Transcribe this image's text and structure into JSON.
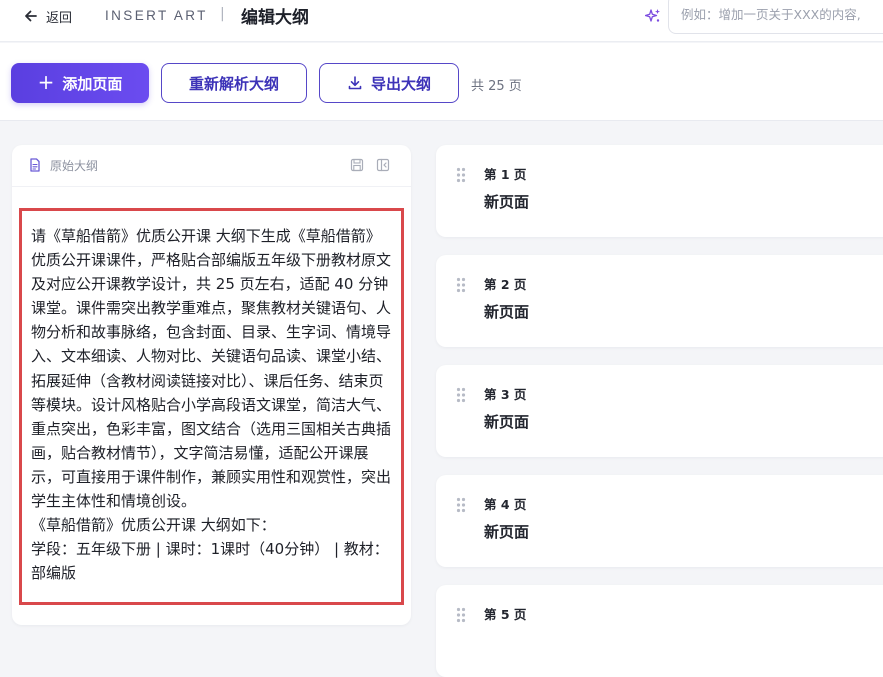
{
  "header": {
    "back_label": "返回",
    "brand": "INSERT ART",
    "separator": "|",
    "title": "编辑大纲",
    "prompt_placeholder": "例如：增加一页关于XXX的内容,"
  },
  "toolbar": {
    "add_page_label": "添加页面",
    "reparse_label": "重新解析大纲",
    "export_label": "导出大纲",
    "page_count": "共 25 页"
  },
  "outline": {
    "label": "原始大纲",
    "text": "请《草船借箭》优质公开课 大纲下生成《草船借箭》优质公开课课件，严格贴合部编版五年级下册教材原文及对应公开课教学设计，共 25 页左右，适配 40 分钟课堂。课件需突出教学重难点，聚焦教材关键语句、人物分析和故事脉络，包含封面、目录、生字词、情境导入、文本细读、人物对比、关键语句品读、课堂小结、拓展延伸（含教材阅读链接对比）、课后任务、结束页等模块。设计风格贴合小学高段语文课堂，简洁大气、重点突出，色彩丰富，图文结合（选用三国相关古典插画，贴合教材情节），文字简洁易懂，适配公开课展示，可直接用于课件制作，兼顾实用性和观赏性，突出学生主体性和情境创设。\n《草船借箭》优质公开课 大纲如下：\n学段：五年级下册 | 课时：1课时（40分钟） | 教材：部编版"
  },
  "pages": [
    {
      "num": "第 1 页",
      "title": "新页面"
    },
    {
      "num": "第 2 页",
      "title": "新页面"
    },
    {
      "num": "第 3 页",
      "title": "新页面"
    },
    {
      "num": "第 4 页",
      "title": "新页面"
    },
    {
      "num": "第 5 页",
      "title": ""
    }
  ],
  "colors": {
    "primary": "#5a3fe0",
    "highlight_border": "#d9484b",
    "background": "#f4f5f8"
  }
}
